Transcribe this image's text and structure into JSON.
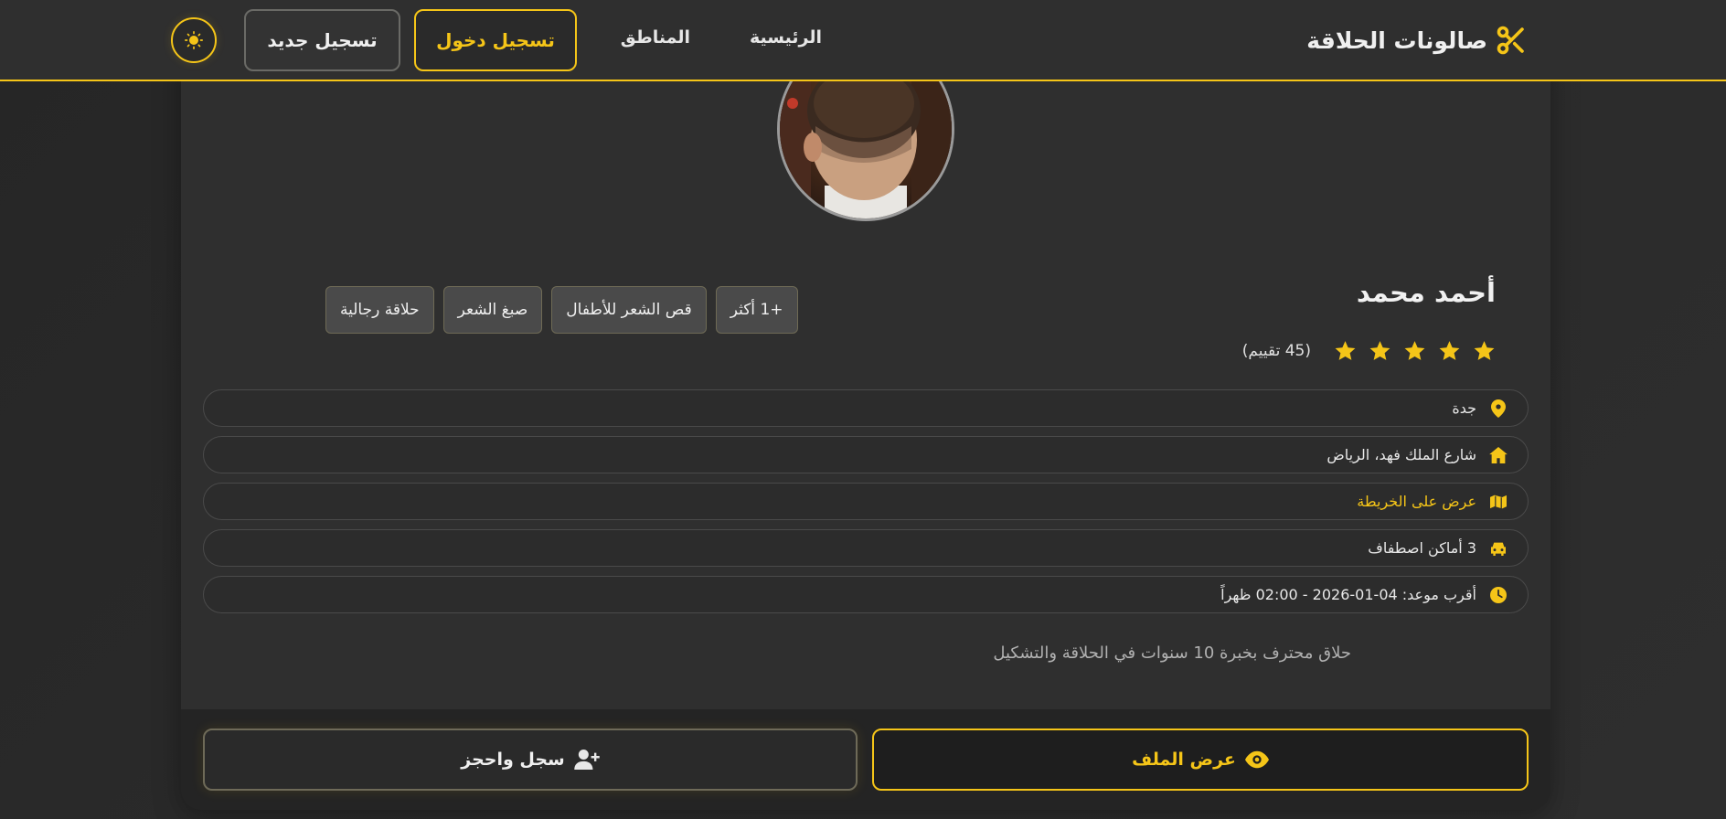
{
  "theme": {
    "accent": "#f5c518",
    "background": "#2b2b2b",
    "card": "#2f2f2f"
  },
  "navbar": {
    "brand": "صالونات الحلاقة",
    "brand_icon": "scissors-icon",
    "home": "الرئيسية",
    "areas": "المناطق",
    "login": "تسجيل دخول",
    "register": "تسجيل جديد",
    "theme_icon": "sun-icon"
  },
  "barber": {
    "name": "أحمد محمد",
    "services": [
      "حلاقة رجالية",
      "صبغ الشعر",
      "قص الشعر للأطفال",
      "+1 أكثر"
    ],
    "rating": 5,
    "rating_count": "(45 تقييم)",
    "city": "جدة",
    "address": "شارع الملك فهد، الرياض",
    "map_link": "عرض على الخريطة",
    "parking": "3 أماكن اصطفاف",
    "next_appointment": "أقرب موعد: 04-01-2026 - 02:00 ظهراً",
    "description": "حلاق محترف بخبرة 10 سنوات في الحلاقة والتشكيل"
  },
  "actions": {
    "view_profile": "عرض الملف",
    "register_book": "سجل واحجز"
  }
}
